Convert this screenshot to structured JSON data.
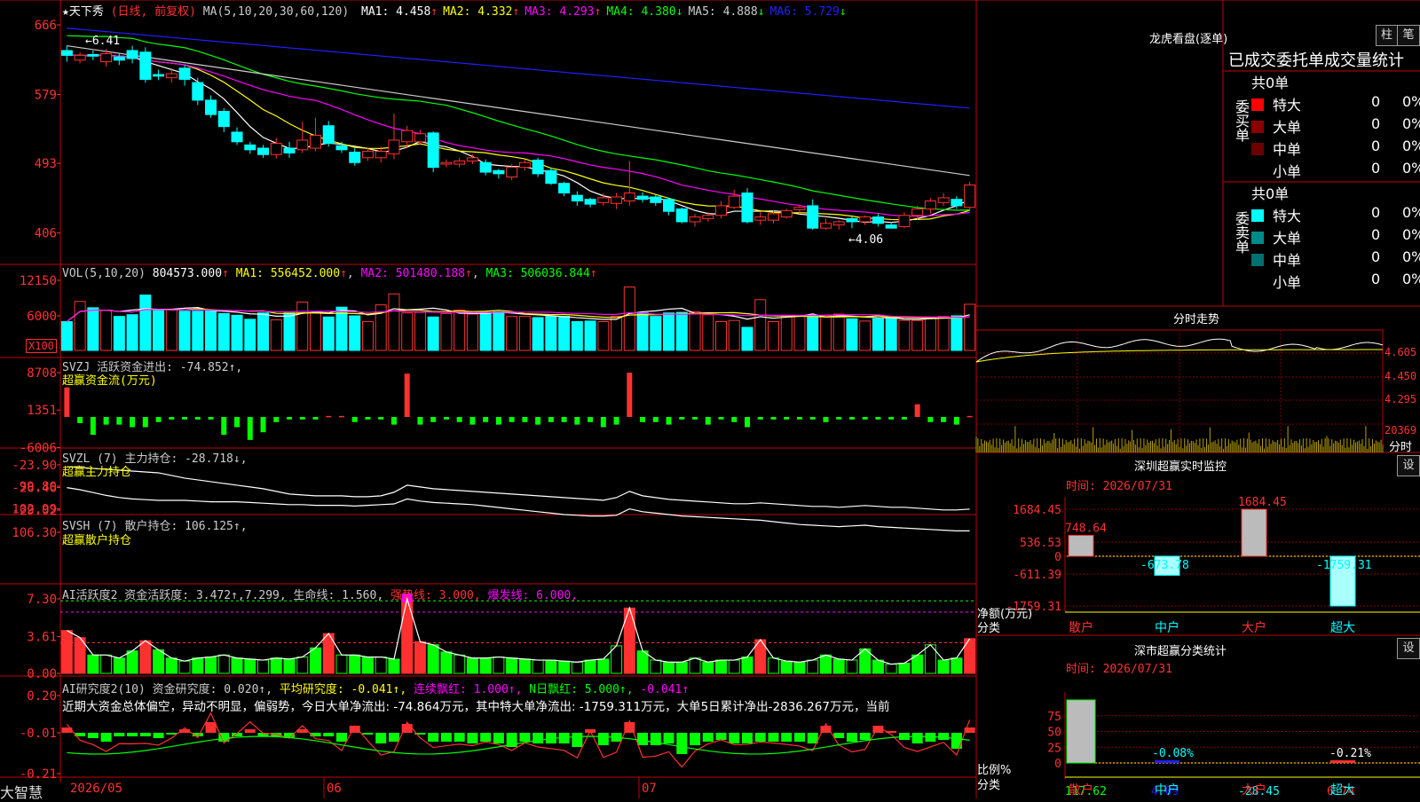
{
  "app": {
    "brand": "大智慧"
  },
  "colors": {
    "up": "#ff3030",
    "down": "#00ffff",
    "green": "#00ff00",
    "yellow": "#ffff00",
    "magenta": "#ff00ff",
    "blue": "#2020ff",
    "white": "#ffffff"
  },
  "main": {
    "stock": "★天下秀",
    "mode": "(日线, 前复权)",
    "ma_label": "MA(5,10,20,30,60,120)",
    "ma": [
      {
        "name": "MA1:",
        "value": "4.458",
        "arrow": "↑",
        "color": "#ffffff"
      },
      {
        "name": "MA2:",
        "value": "4.332",
        "arrow": "↑",
        "color": "#ffff00"
      },
      {
        "name": "MA3:",
        "value": "4.293",
        "arrow": "↑",
        "color": "#ff00ff"
      },
      {
        "name": "MA4:",
        "value": "4.380",
        "arrow": "↓",
        "color": "#00ff00"
      },
      {
        "name": "MA5:",
        "value": "4.888",
        "arrow": "↓",
        "color": "#cccccc"
      },
      {
        "name": "MA6:",
        "value": "5.729",
        "arrow": "↓",
        "color": "#2020ff"
      }
    ],
    "high_mark": "←6.41",
    "low_mark": "←4.06",
    "yticks": [
      "666",
      "579",
      "493",
      "406"
    ],
    "x_labels": [
      "2026/05",
      "06",
      "07"
    ]
  },
  "vol": {
    "label": "VOL(5,10,20)",
    "value": "804573.000",
    "arrow": "↑",
    "ma1": "MA1: 556452.000",
    "ma2": "MA2: 501480.188",
    "ma3": "MA3: 506036.844",
    "yticks": [
      "12150",
      "6000"
    ],
    "unit": "X100"
  },
  "svzj": {
    "line1": "SVZJ  活跃资金进出: -74.852↑,",
    "line2": "超赢资金流(万元)",
    "yticks": [
      "8708",
      "1351",
      "-6006"
    ]
  },
  "svzl": {
    "line1": "SVZL (7) 主力持仓: -28.718↓,",
    "line2": "超赢主力持仓",
    "yticks": [
      "-23.90",
      "-26.46",
      "-29.02"
    ]
  },
  "svsh": {
    "line1": "SVSH (7) 散户持仓: 106.125↑,",
    "line2": "超赢散户持仓",
    "yticks": [
      "106.30",
      "102.99",
      "99.80"
    ]
  },
  "ai1": {
    "label": "AI活跃度2 资金活跃度: 3.472↑,7.299, 生命线: 1.560,",
    "strong": "强势线: 3.000,",
    "burst": "爆发线: 6.000,",
    "yticks": [
      "7.30",
      "3.61",
      "0.00"
    ]
  },
  "ai2": {
    "label": "AI研究度2(10) 资金研究度: 0.020↑,",
    "avg": "平均研究度: -0.041↑,",
    "red": "连续飘红: 1.000↑,",
    "nred": "N日飘红: 5.000↑,",
    "last": "-0.041↑",
    "comment": "近期大资金总体偏空，异动不明显，偏弱势，今日大单净流出: -74.864万元，其中特大单净流出: -1759.311万元，大单5日累计净出-2836.267万元，当前",
    "yticks": [
      "0.20",
      "-0.01",
      "-0.21"
    ]
  },
  "dragon": {
    "title": "龙虎看盘(逐单)",
    "btn_bar": "柱",
    "btn_pen": "笔",
    "header": "已成交委托单成交量统计",
    "buy_side": "委买单",
    "sell_side": "委卖单",
    "buy_total": "共0单",
    "sell_total": "共0单",
    "buy_rows": [
      {
        "name": "特大",
        "count": "0",
        "pct": "0%",
        "color": "#ff0000"
      },
      {
        "name": "大单",
        "count": "0",
        "pct": "0%",
        "color": "#8b0000"
      },
      {
        "name": "中单",
        "count": "0",
        "pct": "0%",
        "color": "#6b0000"
      },
      {
        "name": "小单",
        "count": "0",
        "pct": "0%",
        "color": ""
      }
    ],
    "sell_rows": [
      {
        "name": "特大",
        "count": "0",
        "pct": "0%",
        "color": "#00ffff"
      },
      {
        "name": "大单",
        "count": "0",
        "pct": "0%",
        "color": "#008b8b"
      },
      {
        "name": "中单",
        "count": "0",
        "pct": "0%",
        "color": "#007070"
      },
      {
        "name": "小单",
        "count": "0",
        "pct": "0%",
        "color": ""
      }
    ]
  },
  "intraday": {
    "title": "分时走势",
    "yticks": [
      "4.605",
      "4.450",
      "4.295"
    ],
    "vol_tick": "20369",
    "vol_unit": "分时"
  },
  "monitor": {
    "title": "深圳超赢实时监控",
    "btn": "设",
    "date": "时间: 2026/07/31",
    "yticks": [
      "1684.45",
      "536.53",
      "0",
      "-611.39",
      "-1759.31"
    ],
    "axis_label": "净额(万元)",
    "cat_label": "分类",
    "cats": [
      "散户",
      "中户",
      "大户",
      "超大"
    ],
    "labels": [
      "748.64",
      "-673.78",
      "1684.45",
      "-1759.31"
    ]
  },
  "classify": {
    "title": "深市超赢分类统计",
    "btn": "设",
    "date": "时间: 2026/07/31",
    "yticks": [
      "75",
      "50",
      "25",
      "0"
    ],
    "axis_label": "比例%",
    "cat_label": "分类",
    "cats": [
      "散户",
      "中户",
      "大户",
      "超大"
    ],
    "bar_labels": [
      "-0.08%",
      "-0.21%"
    ],
    "values": [
      "117.62",
      "4.09",
      "-28.45",
      "6.74"
    ]
  },
  "chart_data": [
    {
      "type": "candlestick",
      "ylim": [
        400,
        675
      ],
      "candles": [
        [
          634,
          628,
          640,
          620
        ],
        [
          622,
          628,
          632,
          618
        ],
        [
          629,
          627,
          634,
          622
        ],
        [
          620,
          630,
          636,
          614
        ],
        [
          626,
          622,
          631,
          616
        ],
        [
          634,
          624,
          640,
          618
        ],
        [
          632,
          598,
          638,
          594
        ],
        [
          604,
          602,
          610,
          597
        ],
        [
          600,
          605,
          612,
          594
        ],
        [
          612,
          598,
          616,
          590
        ],
        [
          594,
          572,
          600,
          566
        ],
        [
          572,
          554,
          578,
          550
        ],
        [
          558,
          539,
          562,
          532
        ],
        [
          532,
          520,
          538,
          516
        ],
        [
          516,
          510,
          520,
          505
        ],
        [
          512,
          504,
          516,
          500
        ],
        [
          504,
          518,
          525,
          499
        ],
        [
          512,
          506,
          520,
          500
        ],
        [
          510,
          522,
          545,
          506
        ],
        [
          512,
          528,
          550,
          508
        ],
        [
          540,
          518,
          546,
          514
        ],
        [
          515,
          510,
          520,
          506
        ],
        [
          507,
          494,
          512,
          490
        ],
        [
          500,
          508,
          512,
          496
        ],
        [
          500,
          508,
          514,
          494
        ],
        [
          505,
          522,
          555,
          498
        ],
        [
          520,
          534,
          540,
          512
        ],
        [
          520,
          530,
          535,
          516
        ],
        [
          531,
          488,
          533,
          482
        ],
        [
          492,
          494,
          498,
          488
        ],
        [
          492,
          496,
          500,
          488
        ],
        [
          496,
          500,
          504,
          492
        ],
        [
          494,
          482,
          498,
          478
        ],
        [
          484,
          480,
          486,
          474
        ],
        [
          476,
          488,
          492,
          472
        ],
        [
          488,
          494,
          498,
          484
        ],
        [
          497,
          480,
          500,
          476
        ],
        [
          484,
          468,
          488,
          466
        ],
        [
          468,
          456,
          470,
          452
        ],
        [
          453,
          446,
          458,
          440
        ],
        [
          448,
          442,
          450,
          438
        ],
        [
          444,
          450,
          456,
          440
        ],
        [
          443,
          451,
          456,
          436
        ],
        [
          446,
          456,
          496,
          440
        ],
        [
          452,
          448,
          457,
          444
        ],
        [
          451,
          444,
          454,
          440
        ],
        [
          448,
          433,
          450,
          428
        ],
        [
          436,
          420,
          438,
          418
        ],
        [
          420,
          426,
          430,
          414
        ],
        [
          424,
          428,
          432,
          420
        ],
        [
          428,
          440,
          446,
          424
        ],
        [
          438,
          452,
          460,
          436
        ],
        [
          456,
          420,
          462,
          418
        ],
        [
          422,
          426,
          432,
          416
        ],
        [
          422,
          430,
          434,
          418
        ],
        [
          426,
          434,
          436,
          424
        ],
        [
          435,
          438,
          440,
          430
        ],
        [
          440,
          412,
          448,
          410
        ],
        [
          412,
          418,
          424,
          410
        ],
        [
          416,
          420,
          422,
          410
        ],
        [
          424,
          420,
          426,
          412
        ],
        [
          420,
          426,
          428,
          416
        ],
        [
          426,
          418,
          430,
          414
        ],
        [
          416,
          412,
          420,
          412
        ],
        [
          414,
          428,
          432,
          412
        ],
        [
          428,
          436,
          440,
          422
        ],
        [
          436,
          446,
          450,
          430
        ],
        [
          444,
          450,
          456,
          440
        ],
        [
          448,
          440,
          452,
          436
        ],
        [
          438,
          466,
          470,
          434
        ]
      ]
    },
    {
      "type": "bar",
      "series": [
        {
          "values": [
            5,
            8.5,
            7.4,
            7,
            5.9,
            6.2,
            9.6,
            7,
            7,
            6.8,
            6.8,
            7,
            6.4,
            6.1,
            5.4,
            6.5,
            5.3,
            6.5,
            8.4,
            6.5,
            5.8,
            7.5,
            6,
            5,
            7.9,
            9.8,
            6.5,
            6.6,
            5.8,
            6.4,
            7,
            6.3,
            6.6,
            6.7,
            5.9,
            5.9,
            5.7,
            5.9,
            5.9,
            5,
            5.1,
            5,
            5.9,
            11,
            6.5,
            5.9,
            6.5,
            6.6,
            6.7,
            6.2,
            5,
            5.2,
            4,
            8.8,
            5,
            5.9,
            5.9,
            6,
            6,
            6.3,
            5.5,
            5.1,
            5.5,
            5.9,
            5.2,
            5.2,
            5.8,
            5.9,
            6,
            8
          ]
        }
      ]
    },
    {
      "type": "bar",
      "series": [
        {
          "values": [
            5800,
            -1200,
            -3500,
            -1500,
            -1500,
            -2000,
            -2000,
            -1000,
            -500,
            -500,
            -500,
            -500,
            -3500,
            -2000,
            -4500,
            -3000,
            -1000,
            -500,
            -500,
            -500,
            200,
            200,
            -1000,
            -500,
            -500,
            -1500,
            8500,
            -1500,
            -1000,
            -500,
            -1000,
            -1500,
            -1000,
            -1500,
            -1000,
            -1000,
            -1500,
            -1000,
            -1000,
            -1500,
            -1000,
            -2000,
            -1500,
            8700,
            -1000,
            -1000,
            -1500,
            -500,
            -500,
            -1500,
            -500,
            -1000,
            -2000,
            -500,
            -500,
            -500,
            -500,
            -500,
            -1000,
            -500,
            -500,
            -500,
            -500,
            -500,
            -500,
            2500,
            -1000,
            -1000,
            -1500,
            200
          ]
        }
      ]
    },
    {
      "type": "line",
      "series": [
        {
          "name": "主力持仓",
          "values": [
            -24.1,
            -24.2,
            -24.3,
            -24.4,
            -24.5,
            -24.6,
            -24.7,
            -24.8,
            -25.1,
            -25.4,
            -25.6,
            -25.8,
            -26.0,
            -26.2,
            -26.4,
            -26.6,
            -26.9,
            -27.2,
            -27.3,
            -27.4,
            -27.4,
            -27.4,
            -27.5,
            -27.5,
            -27.4,
            -27.0,
            -26.2,
            -26.4,
            -26.6,
            -26.7,
            -26.8,
            -26.9,
            -27.0,
            -27.1,
            -27.2,
            -27.3,
            -27.4,
            -27.5,
            -27.6,
            -27.7,
            -27.8,
            -27.9,
            -27.6,
            -26.9,
            -27.4,
            -27.6,
            -27.8,
            -27.9,
            -28.0,
            -28.1,
            -28.2,
            -28.3,
            -28.3,
            -28.2,
            -28.3,
            -28.4,
            -28.5,
            -28.6,
            -28.6,
            -28.7,
            -28.6,
            -28.5,
            -28.6,
            -28.7,
            -28.7,
            -28.8,
            -28.9,
            -29.0,
            -29.0,
            -28.9
          ]
        }
      ]
    },
    {
      "type": "line",
      "series": [
        {
          "name": "散户持仓",
          "values": [
            100.0,
            100.3,
            100.7,
            101.1,
            101.4,
            101.6,
            101.7,
            101.8,
            101.8,
            101.8,
            101.9,
            102.0,
            102.0,
            102.0,
            102.1,
            102.2,
            102.3,
            102.4,
            102.4,
            102.5,
            102.5,
            102.5,
            102.6,
            102.5,
            102.4,
            102.3,
            101.6,
            101.9,
            102.1,
            102.2,
            102.3,
            102.4,
            102.6,
            102.8,
            103.0,
            103.2,
            103.4,
            103.6,
            103.8,
            103.9,
            104.0,
            104.0,
            103.9,
            103.0,
            103.4,
            103.6,
            103.8,
            104.0,
            104.1,
            104.2,
            104.3,
            104.4,
            104.5,
            104.6,
            104.8,
            105.0,
            105.2,
            105.3,
            105.4,
            105.5,
            105.4,
            105.3,
            105.5,
            105.6,
            105.7,
            105.8,
            105.9,
            106.0,
            106.1,
            106.1
          ]
        }
      ]
    },
    {
      "type": "bar",
      "series": [
        {
          "name": "资金活跃度",
          "values": [
            4.2,
            3.5,
            1.8,
            1.8,
            1.5,
            2.2,
            3.2,
            2.3,
            1.5,
            1.2,
            1.5,
            1.6,
            1.8,
            1.5,
            1.4,
            1.3,
            1.5,
            1.4,
            1.6,
            2.5,
            3.9,
            1.8,
            1.8,
            1.6,
            1.6,
            1.4,
            7.3,
            3.1,
            2.8,
            2.1,
            1.8,
            1.5,
            1.5,
            1.6,
            1.5,
            1.4,
            1.3,
            1.3,
            1.2,
            1.1,
            1.3,
            1.4,
            2.7,
            6.4,
            2.2,
            1.3,
            1.1,
            1.1,
            1.5,
            1.1,
            1.3,
            1.3,
            1.6,
            3.3,
            1.5,
            1.2,
            1.1,
            1.3,
            1.8,
            1.4,
            1.3,
            2.4,
            1.3,
            0.9,
            1.0,
            1.8,
            2.8,
            1.3,
            1.5,
            3.4
          ]
        }
      ],
      "lines": {
        "strong": 3.0,
        "burst": 6.0
      }
    },
    {
      "type": "bar",
      "series": [
        {
          "name": "资金研究度",
          "values": [
            0.03,
            -0.02,
            -0.03,
            -0.05,
            -0.02,
            -0.02,
            -0.02,
            -0.03,
            -0.01,
            0.02,
            -0.02,
            0.06,
            -0.05,
            -0.02,
            0.02,
            -0.02,
            -0.02,
            -0.03,
            0.02,
            -0.02,
            -0.02,
            -0.05,
            0.04,
            -0.01,
            -0.06,
            -0.05,
            0.05,
            -0.01,
            -0.05,
            -0.05,
            -0.05,
            -0.06,
            -0.05,
            -0.06,
            -0.08,
            -0.05,
            -0.06,
            -0.06,
            -0.06,
            -0.08,
            0.02,
            -0.07,
            -0.05,
            0.06,
            -0.07,
            -0.07,
            -0.06,
            -0.12,
            -0.07,
            -0.05,
            -0.04,
            -0.06,
            -0.06,
            -0.05,
            -0.05,
            -0.05,
            -0.05,
            -0.06,
            0.04,
            -0.03,
            -0.05,
            -0.04,
            0.04,
            0.01,
            -0.04,
            -0.06,
            -0.05,
            -0.04,
            -0.09,
            0.03
          ]
        }
      ]
    }
  ]
}
